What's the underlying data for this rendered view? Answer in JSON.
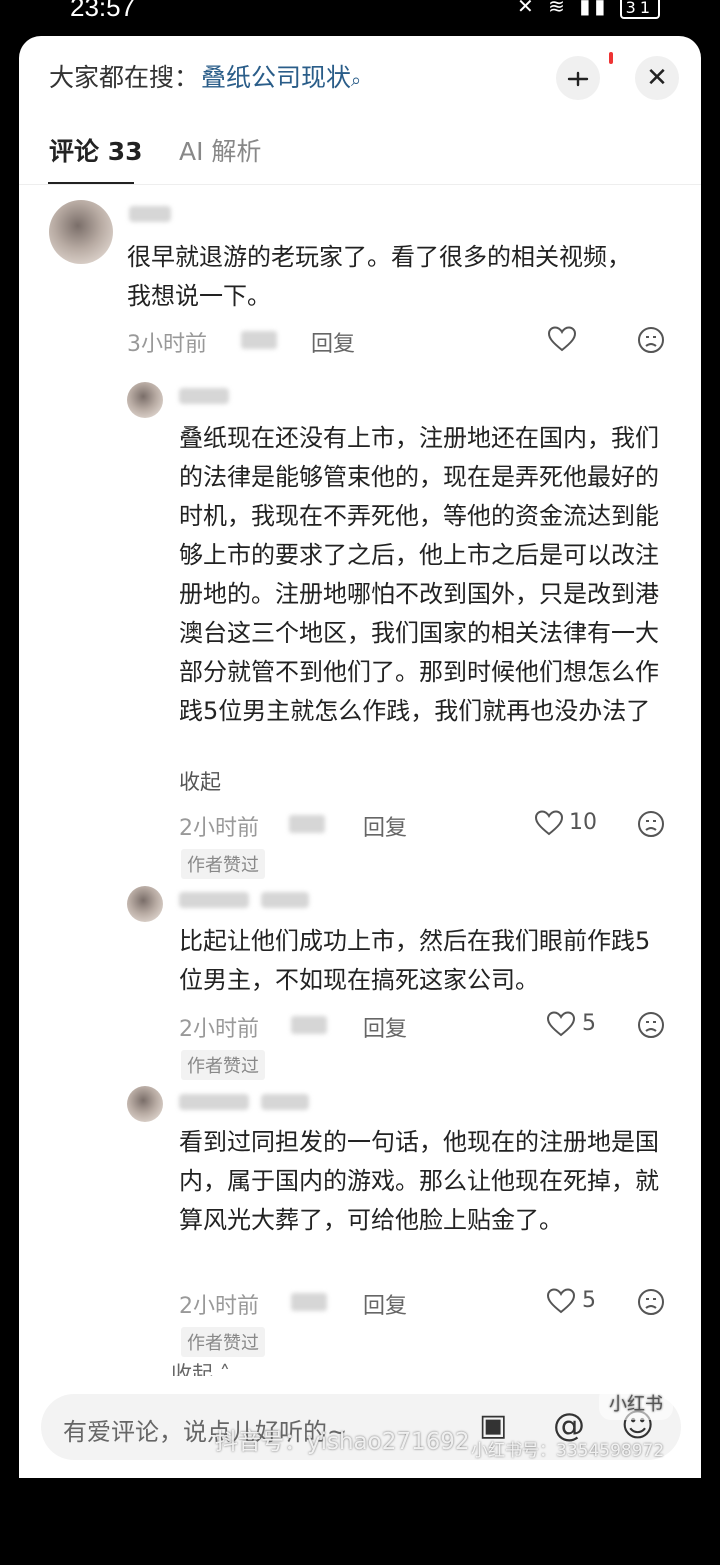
{
  "status_bar": {
    "time": "23:57",
    "battery": "31"
  },
  "header": {
    "search_prefix": "大家都在搜：",
    "search_query": "叠纸公司现状",
    "tabs": [
      {
        "label": "评论 33",
        "active": true
      },
      {
        "label": "AI 解析",
        "active": false
      }
    ]
  },
  "comments": [
    {
      "text": "很早就退游的老玩家了。看了很多的相关视频，我想说一下。",
      "time": "3小时前",
      "reply_label": "回复",
      "likes": "",
      "author_liked": ""
    },
    {
      "text": "叠纸现在还没有上市，注册地还在国内，我们的法律是能够管束他的，现在是弄死他最好的时机，我现在不弄死他，等他的资金流达到能够上市的要求了之后，他上市之后是可以改注册地的。注册地哪怕不改到国外，只是改到港澳台这三个地区，我们国家的相关法律有一大部分就管不到他们了。那到时候他们想怎么作践5位男主就怎么作践，我们就再也没办法了",
      "collapse": "收起",
      "time": "2小时前",
      "reply_label": "回复",
      "likes": "10",
      "author_liked": "作者赞过"
    },
    {
      "text": "比起让他们成功上市，然后在我们眼前作践5位男主，不如现在搞死这家公司。",
      "time": "2小时前",
      "reply_label": "回复",
      "likes": "5",
      "author_liked": "作者赞过"
    },
    {
      "text": "看到过同担发的一句话，他现在的注册地是国内，属于国内的游戏。那么让他现在死掉，就算风光大葬了，可给他脸上贴金了。",
      "time": "2小时前",
      "reply_label": "回复",
      "likes": "5",
      "author_liked": "作者赞过"
    }
  ],
  "thread_collapse": "收起",
  "input": {
    "placeholder": "有爱评论，说点儿好听的~"
  },
  "watermarks": {
    "douyin": "抖音号：yishao271692",
    "xhs_logo": "小红书",
    "xhs_id": "小红书号：3354598972"
  }
}
